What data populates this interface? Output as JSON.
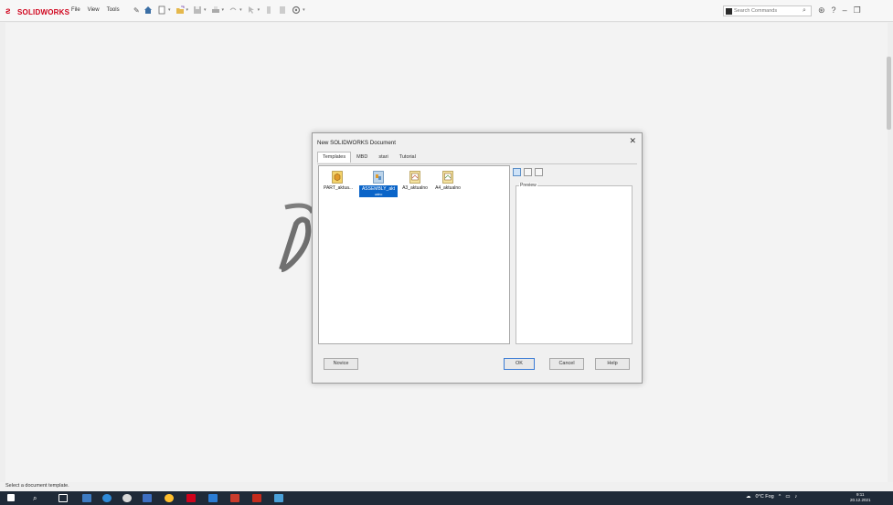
{
  "app": {
    "logo_text": "SOLIDWORKS",
    "menu": [
      "File",
      "View",
      "Tools"
    ],
    "search_placeholder": "Search Commands",
    "status_text": "Select a document template."
  },
  "dialog": {
    "title": "New SOLIDWORKS Document",
    "tabs": [
      "Templates",
      "MBD",
      "stari",
      "Tutorial"
    ],
    "active_tab": "Templates",
    "files": [
      {
        "label": "PART_aktua...",
        "icon": "part-template-icon"
      },
      {
        "label": "ASSEMBLY_akt",
        "sub": "ualno",
        "icon": "assembly-template-icon",
        "selected": true
      },
      {
        "label": "A3_aktualno",
        "icon": "drawing-template-icon"
      },
      {
        "label": "A4_aktualno",
        "icon": "drawing-template-icon"
      }
    ],
    "preview_label": "Preview",
    "buttons": {
      "novice": "Novice",
      "ok": "OK",
      "cancel": "Cancel",
      "help": "Help"
    }
  },
  "taskbar": {
    "weather": "0°C Fog",
    "time": "9:11",
    "date": "20.12.2021"
  },
  "colors": {
    "brand": "#d0021b",
    "selection": "#0a64c8",
    "taskbar": "#1f2a38"
  }
}
